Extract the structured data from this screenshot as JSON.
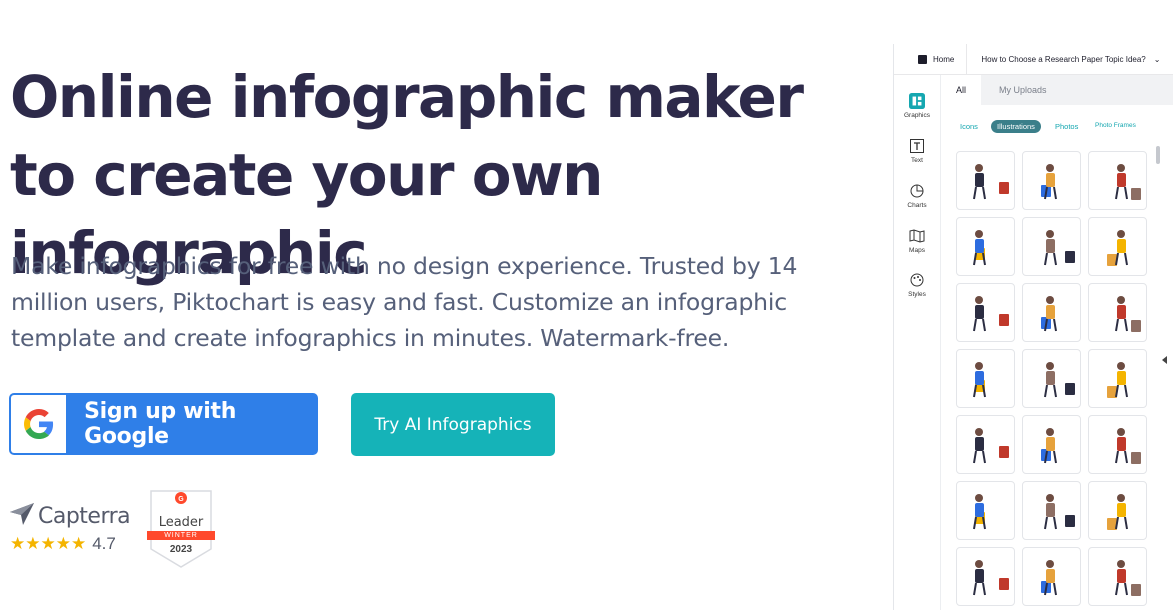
{
  "hero": {
    "title": "Online infographic maker to create your own infographic",
    "subtitle": "Make infographics for free with no design experience. Trusted by 14 million users, Piktochart is easy and fast. Customize an infographic template and create infographics in minutes. Watermark-free."
  },
  "buttons": {
    "google_label": "Sign up with Google",
    "ai_label": "Try AI Infographics"
  },
  "badges": {
    "capterra_name": "Capterra",
    "capterra_stars": "★★★★★",
    "capterra_score": "4.7",
    "g2_leader": "Leader",
    "g2_season": "WINTER",
    "g2_year": "2023"
  },
  "editor": {
    "home_label": "Home",
    "doc_title": "How to Choose a  Research Paper Topic Idea?",
    "sidebar": [
      {
        "label": "Graphics",
        "icon": "graphics-icon"
      },
      {
        "label": "Text",
        "icon": "text-icon"
      },
      {
        "label": "Charts",
        "icon": "charts-icon"
      },
      {
        "label": "Maps",
        "icon": "maps-icon"
      },
      {
        "label": "Styles",
        "icon": "styles-icon"
      }
    ],
    "tabs": {
      "all": "All",
      "uploads": "My Uploads"
    },
    "filters": {
      "icons": "Icons",
      "illustrations": "Illustrations",
      "photos": "Photos",
      "photo_frames": "Photo Frames"
    }
  },
  "colors": {
    "title": "#2d2a4a",
    "google_blue": "#2f7fe8",
    "ai_teal": "#15b3b8",
    "filter_active": "#3b7f8a"
  }
}
